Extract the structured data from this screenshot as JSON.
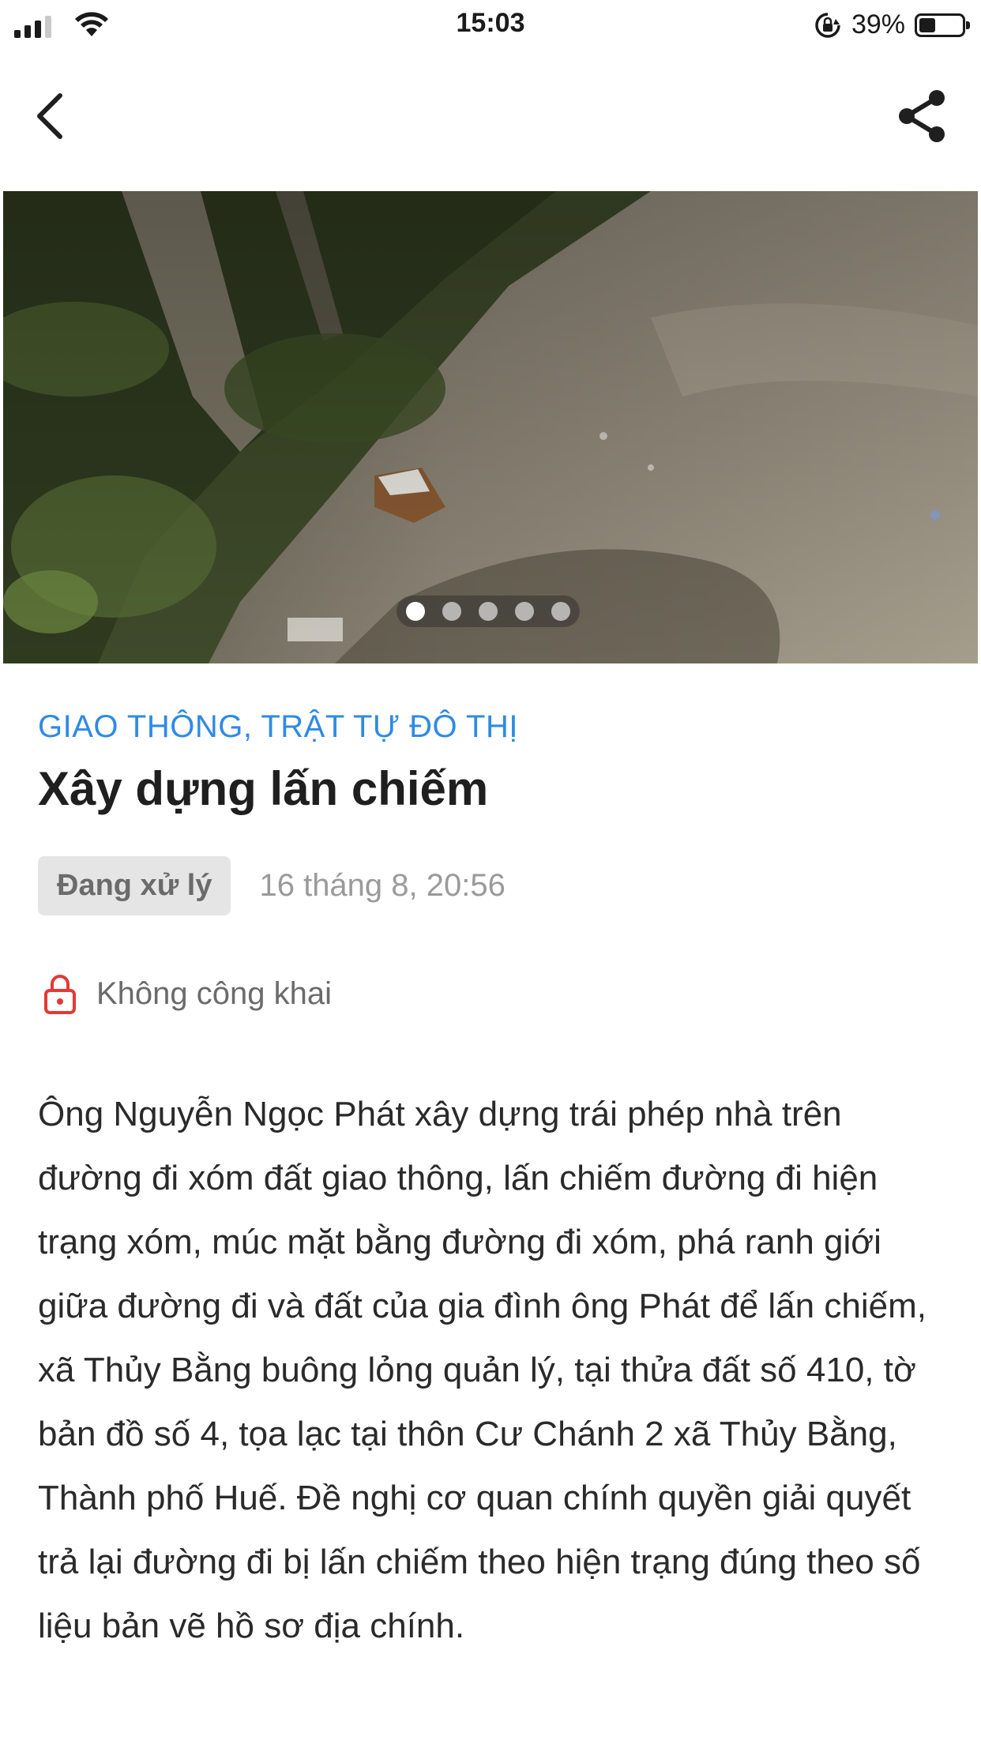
{
  "status_bar": {
    "time": "15:03",
    "battery_percent_label": "39%",
    "battery_level": 0.39
  },
  "nav": {
    "back_icon": "chevron-left-icon",
    "share_icon": "share-icon"
  },
  "carousel": {
    "slide_count": 5,
    "active_index": 0
  },
  "report": {
    "category": "GIAO THÔNG, TRẬT TỰ ĐÔ THỊ",
    "title": "Xây dựng lấn chiếm",
    "status": "Đang xử lý",
    "timestamp": "16 tháng 8, 20:56",
    "privacy": "Không công khai",
    "description": "Ông Nguyễn Ngọc Phát xây dựng trái phép nhà trên đường đi xóm đất giao thông, lấn chiếm đường đi hiện trạng xóm, múc mặt bằng đường đi xóm, phá ranh giới giữa đường đi và đất của gia đình ông Phát để lấn chiếm, xã Thủy Bằng buông lỏng quản lý, tại thửa đất số 410, tờ bản đồ số 4, tọa lạc tại thôn Cư Chánh 2 xã Thủy Bằng, Thành phố Huế. Đề nghị cơ quan chính quyền giải quyết trả lại đường đi bị lấn chiếm theo hiện trạng đúng theo số liệu bản vẽ hồ sơ địa chính."
  },
  "colors": {
    "category": "#2f8ae5",
    "lock": "#e53935",
    "badge_bg": "#e5e5e5"
  }
}
